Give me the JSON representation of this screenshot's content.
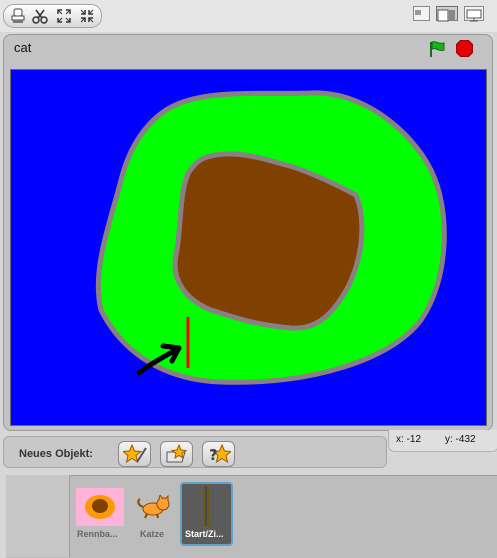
{
  "sprite": {
    "name": "cat"
  },
  "new_object": {
    "label": "Neues Objekt:"
  },
  "coordinates": {
    "x": "x: -12",
    "y": "y: -432"
  },
  "sprites": [
    {
      "name": "Rennba...",
      "selected": false
    },
    {
      "name": "Katze",
      "selected": false
    },
    {
      "name": "Start/Zi...",
      "selected": true
    }
  ],
  "colors": {
    "stage_bg": "#0000ff",
    "field": "#00ff00",
    "infield": "#804000",
    "line": "#ff0000",
    "outline": "#8a7f82"
  }
}
